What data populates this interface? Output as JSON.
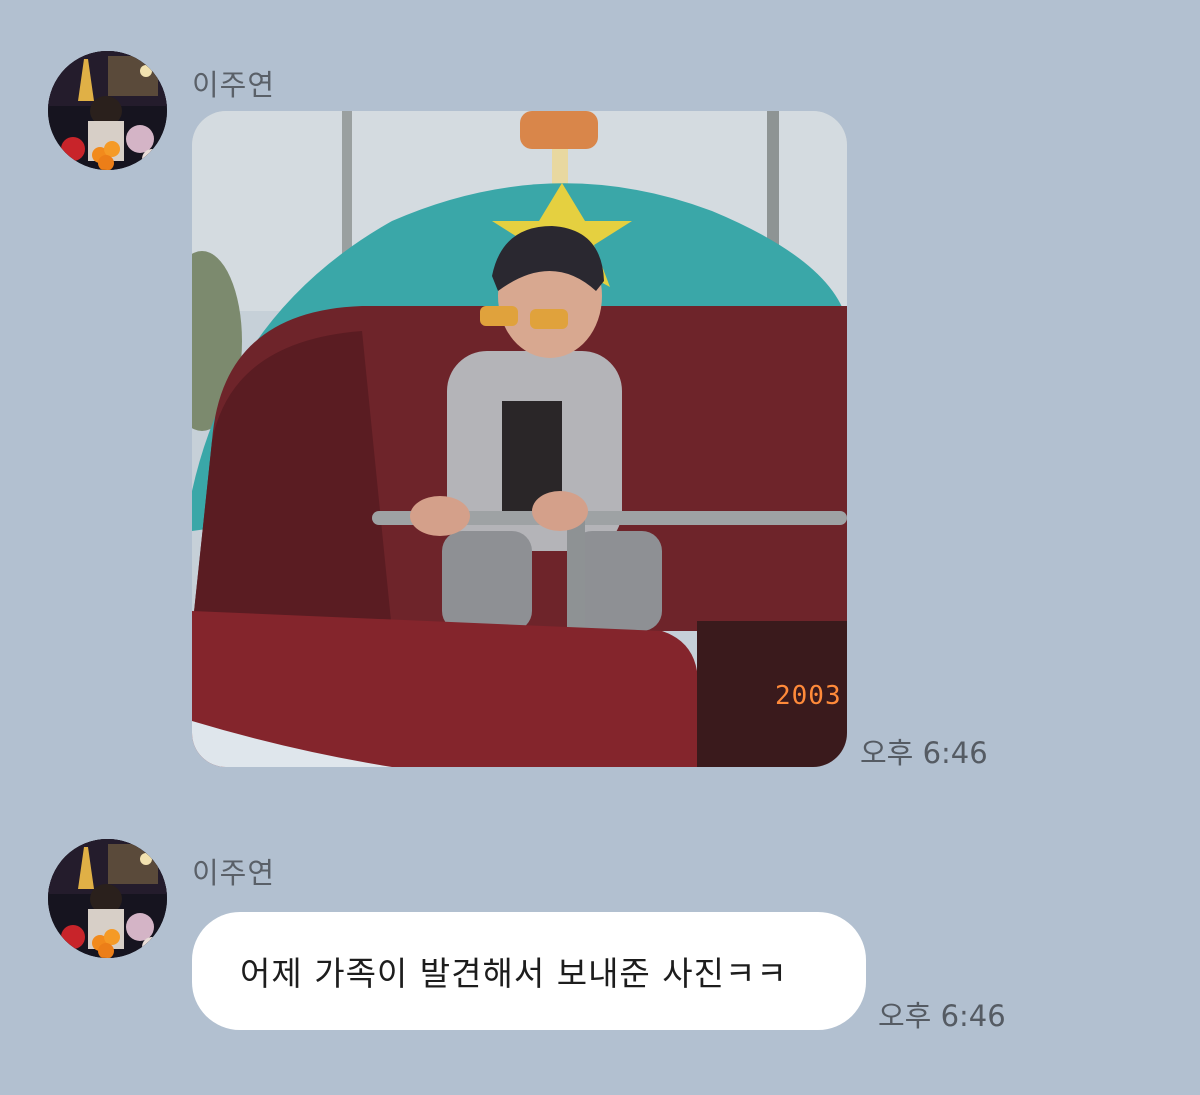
{
  "chat": {
    "messages": [
      {
        "sender": "이주연",
        "type": "photo",
        "photo_date_stamp": "2003",
        "time": "오후 6:46"
      },
      {
        "sender": "이주연",
        "type": "text",
        "text": "어제 가족이 발견해서 보내준 사진ㅋㅋ",
        "time": "오후 6:46"
      }
    ]
  },
  "colors": {
    "background": "#b2c0d0",
    "bubble": "#ffffff",
    "timestamp": "#555b63"
  }
}
